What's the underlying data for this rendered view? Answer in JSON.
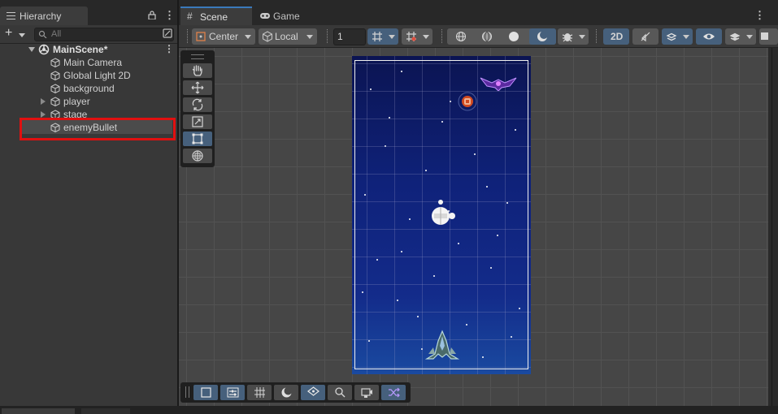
{
  "hierarchy": {
    "tab_label": "Hierarchy",
    "search_placeholder": "All",
    "scene_name": "MainScene*",
    "items": [
      {
        "label": "Main Camera",
        "expandable": false
      },
      {
        "label": "Global Light 2D",
        "expandable": false
      },
      {
        "label": "background",
        "expandable": false
      },
      {
        "label": "player",
        "expandable": true
      },
      {
        "label": "stage",
        "expandable": true
      },
      {
        "label": "enemyBullet",
        "expandable": false,
        "selected": true
      }
    ]
  },
  "tabs": {
    "scene": "Scene",
    "game": "Game"
  },
  "scene_toolbar": {
    "pivot_mode": "Center",
    "pivot_space": "Local",
    "grid_snap_value": "1",
    "mode_2d": "2D"
  },
  "colors": {
    "accent": "#3a79bb",
    "selected_tool": "#46607c",
    "highlight_box": "#e01010"
  }
}
